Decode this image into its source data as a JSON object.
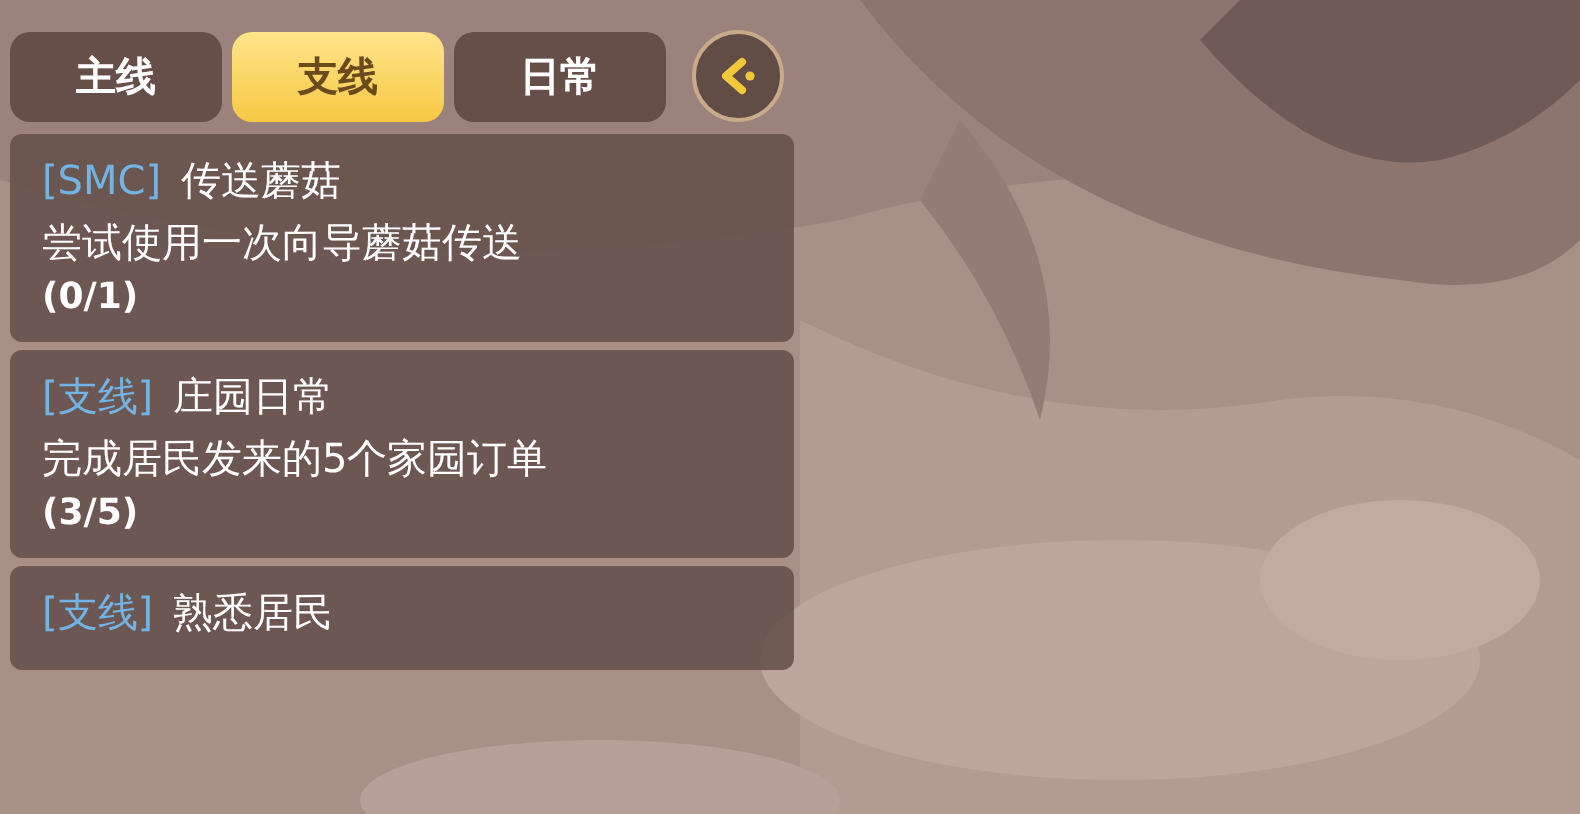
{
  "tabs": [
    {
      "label": "主线",
      "selected": false
    },
    {
      "label": "支线",
      "selected": true
    },
    {
      "label": "日常",
      "selected": false
    }
  ],
  "quests": [
    {
      "tag": "[SMC]",
      "title": "传送蘑菇",
      "description": "尝试使用一次向导蘑菇传送",
      "progress": "(0/1)"
    },
    {
      "tag": "[支线]",
      "title": "庄园日常",
      "description": "完成居民发来的5个家园订单",
      "progress": "(3/5)"
    },
    {
      "tag": "[支线]",
      "title": "熟悉居民"
    }
  ]
}
